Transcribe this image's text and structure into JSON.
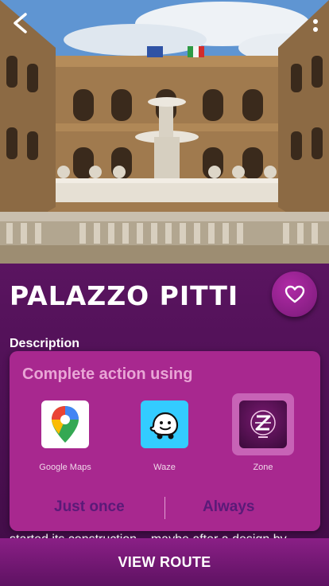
{
  "place": {
    "title": "PALAZZO PITTI",
    "description_label": "Description",
    "description_text": "started its construction... maybe after a design by"
  },
  "dialog": {
    "title": "Complete action using",
    "apps": [
      {
        "label": "Google Maps",
        "icon": "google-maps-icon"
      },
      {
        "label": "Waze",
        "icon": "waze-icon"
      },
      {
        "label": "Zone",
        "icon": "zone-icon",
        "selected": true
      }
    ],
    "just_once": "Just once",
    "always": "Always"
  },
  "bottom": {
    "route_label": "VIEW ROUTE"
  },
  "colors": {
    "background": "#4a0e4e",
    "dialog": "#a8288f",
    "dialog_title": "#e9a6d6",
    "action_text": "#5a1a78",
    "fav_button": "#8a1f86"
  }
}
